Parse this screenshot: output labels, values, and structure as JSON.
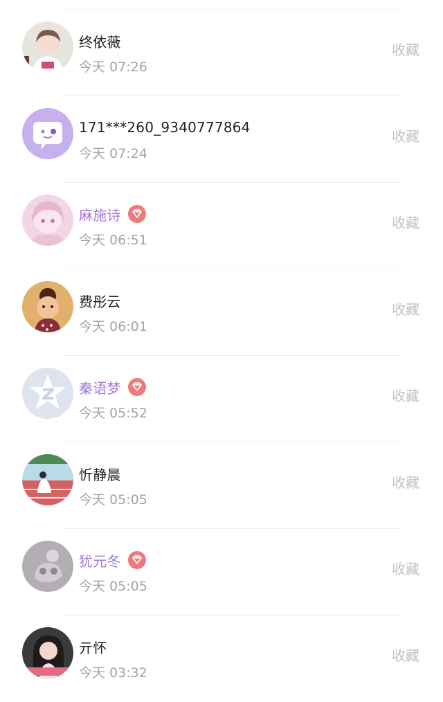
{
  "contacts": [
    {
      "name": "终依薇",
      "time": "今天 07:26",
      "vip": false,
      "avatar": "photo-avatar",
      "action": "收藏"
    },
    {
      "name": "171***260_9340777864",
      "time": "今天 07:24",
      "vip": false,
      "avatar": "default-chat-avatar",
      "action": "收藏"
    },
    {
      "name": "麻施诗",
      "time": "今天 06:51",
      "vip": true,
      "avatar": "photo-avatar",
      "action": "收藏"
    },
    {
      "name": "费彤云",
      "time": "今天 06:01",
      "vip": false,
      "avatar": "photo-avatar",
      "action": "收藏"
    },
    {
      "name": "秦语梦",
      "time": "今天 05:52",
      "vip": true,
      "avatar": "default-star-avatar",
      "action": "收藏"
    },
    {
      "name": "忻静晨",
      "time": "今天 05:05",
      "vip": false,
      "avatar": "photo-avatar",
      "action": "收藏"
    },
    {
      "name": "犹元冬",
      "time": "今天 05:05",
      "vip": true,
      "avatar": "photo-avatar",
      "action": "收藏"
    },
    {
      "name": "亓怀",
      "time": "今天 03:32",
      "vip": false,
      "avatar": "photo-avatar",
      "action": "收藏"
    }
  ],
  "colors": {
    "vip_name": "#a57ad6",
    "vip_badge": "#ee7a7a",
    "time_text": "#a3a3a8",
    "action_text": "#c2c2c6"
  }
}
